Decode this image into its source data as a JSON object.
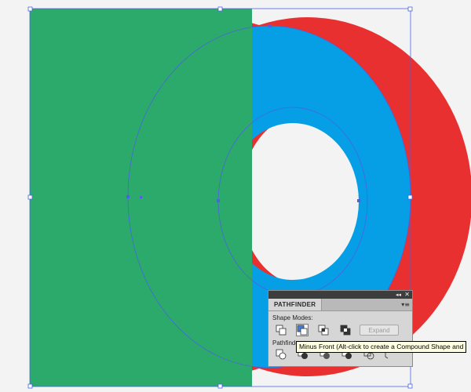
{
  "canvas": {
    "background_color": "#f3f3f4",
    "shapes": [
      {
        "name": "green-rectangle",
        "color": "#2caa6b"
      },
      {
        "name": "blue-ring",
        "color": "#069ee4"
      },
      {
        "name": "red-ring",
        "color": "#e83030"
      }
    ],
    "selection_color": "#4a63e0"
  },
  "pathfinder_panel": {
    "title": "PATHFINDER",
    "collapse_glyph": "◂◂",
    "close_glyph": "✕",
    "menu_glyph": "▾≡",
    "shape_modes_label": "Shape Modes:",
    "shape_mode_buttons": [
      {
        "name": "unite-icon"
      },
      {
        "name": "minus-front-icon",
        "active": true
      },
      {
        "name": "intersect-icon"
      },
      {
        "name": "exclude-icon"
      }
    ],
    "expand_label": "Expand",
    "pathfinders_label": "Pathfinders:",
    "pathfinder_buttons": [
      {
        "name": "divide-icon"
      },
      {
        "name": "trim-icon"
      },
      {
        "name": "merge-icon"
      },
      {
        "name": "crop-icon"
      },
      {
        "name": "outline-icon"
      },
      {
        "name": "minus-back-icon"
      }
    ]
  },
  "tooltip": {
    "text": "Minus Front (Alt-click to create a Compound Shape and"
  }
}
